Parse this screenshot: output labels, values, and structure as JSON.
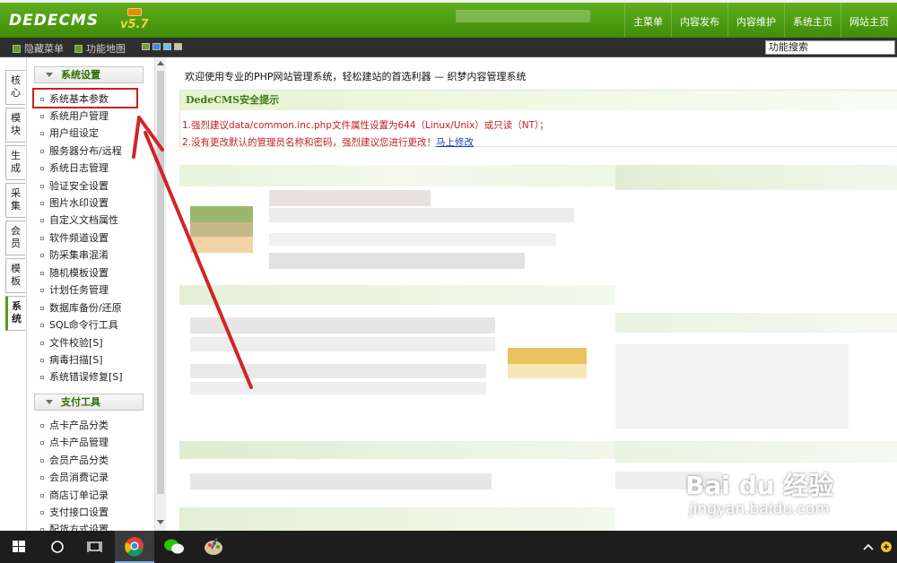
{
  "header": {
    "logo_text": "DEDECMS",
    "logo_version": "v5.7",
    "nav": [
      "主菜单",
      "内容发布",
      "内容维护",
      "系统主页",
      "网站主页"
    ]
  },
  "toolbar": {
    "hide_menu": "隐藏菜单",
    "function_map": "功能地图",
    "search_label": "功能搜索"
  },
  "vertical_tabs": [
    "核心",
    "模块",
    "生成",
    "采集",
    "会员",
    "模板",
    "系统"
  ],
  "menu": {
    "section1_title": "系统设置",
    "section1_items": [
      "系统基本参数",
      "系统用户管理",
      "用户组设定",
      "服务器分布/远程",
      "系统日志管理",
      "验证安全设置",
      "图片水印设置",
      "自定义文档属性",
      "软件频道设置",
      "防采集串混淆",
      "随机模板设置",
      "计划任务管理",
      "数据库备份/还原",
      "SQL命令行工具",
      "文件校验[S]",
      "病毒扫描[S]",
      "系统错误修复[S]"
    ],
    "section2_title": "支付工具",
    "section2_items": [
      "点卡产品分类",
      "点卡产品管理",
      "会员产品分类",
      "会员消费记录",
      "商店订单记录",
      "支付接口设置",
      "配货方式设置"
    ]
  },
  "main": {
    "welcome": "欢迎使用专业的PHP网站管理系统，轻松建站的首选利器 — 织梦内容管理系统",
    "security_title": "DedeCMS安全提示",
    "security_line1": "1.强烈建议data/common.inc.php文件属性设置为644（Linux/Unix）或只读（NT）；",
    "security_line2": "2.没有更改默认的管理员名称和密码，强烈建议您进行更改！",
    "security_link": "马上修改"
  },
  "watermark": {
    "brand": "Bai du 经验",
    "url": "jingyan.baidu.com"
  },
  "colors": {
    "header_green": "#4a9a12",
    "highlight_red": "#cc1f1f",
    "warning_text": "#c31f1f"
  }
}
